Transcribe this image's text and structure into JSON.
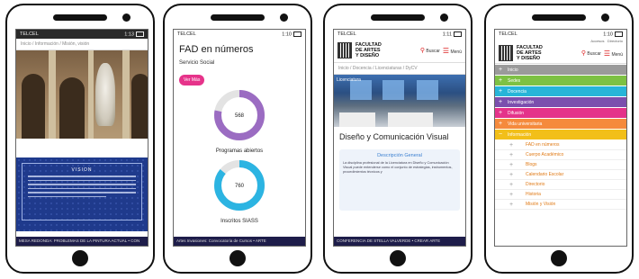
{
  "phones": [
    {
      "status": {
        "carrier": "TELCEL",
        "time": "1:13"
      },
      "breadcrumb": "Inicio / Información / Misión, visión",
      "vision_title": "VISION",
      "ticker": "MESA REDONDA: PROBLEMAS DE LA PINTURA ACTUAL  •  CON"
    },
    {
      "status": {
        "carrier": "TELCEL",
        "time": "1:10"
      },
      "title": "FAD en números",
      "subtitle": "Servicio Social",
      "pill": "Ver Más",
      "rings": [
        {
          "value": "568",
          "label": "Programas abiertos",
          "fraction": 0.78,
          "color": "#9b6cc2"
        },
        {
          "value": "760",
          "label": "Inscritos SIASS",
          "fraction": 0.86,
          "color": "#2cb4e2"
        }
      ],
      "ticker": "Artes Invasiones: Convocatoria de Cursos  •  ARTE"
    },
    {
      "status": {
        "carrier": "TELCEL",
        "time": "1:11"
      },
      "brand": [
        "FACULTAD",
        "DE ARTES",
        "Y DISEÑO"
      ],
      "search": "Buscar",
      "menu": "Menú",
      "breadcrumb": "Inicio / Docencia / Licenciaturas / DyCV",
      "image_label": "Licenciatura",
      "title": "Diseño y Comunicación Visual",
      "card_title": "Descripción General",
      "card_text": "La disciplina profesional de la Licenciatura en Diseño y Comunicación Visual puede entenderse como el conjunto de estrategias, instrumentos, procedimientos técnicos y",
      "ticker": "CONFERENCIA DE STELLA VALVERDE  •  CREAR ARTE"
    },
    {
      "status": {
        "carrier": "TELCEL",
        "time": "1:10"
      },
      "top_links": [
        "Accesos",
        "Directorio"
      ],
      "brand": [
        "FACULTAD",
        "DE ARTES",
        "Y DISEÑO"
      ],
      "search": "Buscar",
      "menu": "Menú",
      "main_items": [
        {
          "label": "Inicio",
          "color": "#9a9a9a"
        },
        {
          "label": "Sedes",
          "color": "#7dc143"
        },
        {
          "label": "Docencia",
          "color": "#27b5d8"
        },
        {
          "label": "Investigación",
          "color": "#7b4fae"
        },
        {
          "label": "Difusión",
          "color": "#e4338a"
        },
        {
          "label": "Vida universitaria",
          "color": "#f58a3c"
        },
        {
          "label": "Información",
          "color": "#f2bf19"
        }
      ],
      "sub_items": [
        "FAD en números",
        "Cuerpo Académico",
        "Blogs",
        "Calendario Escolar",
        "Directorio",
        "Historia",
        "Misión y Visión"
      ]
    }
  ]
}
